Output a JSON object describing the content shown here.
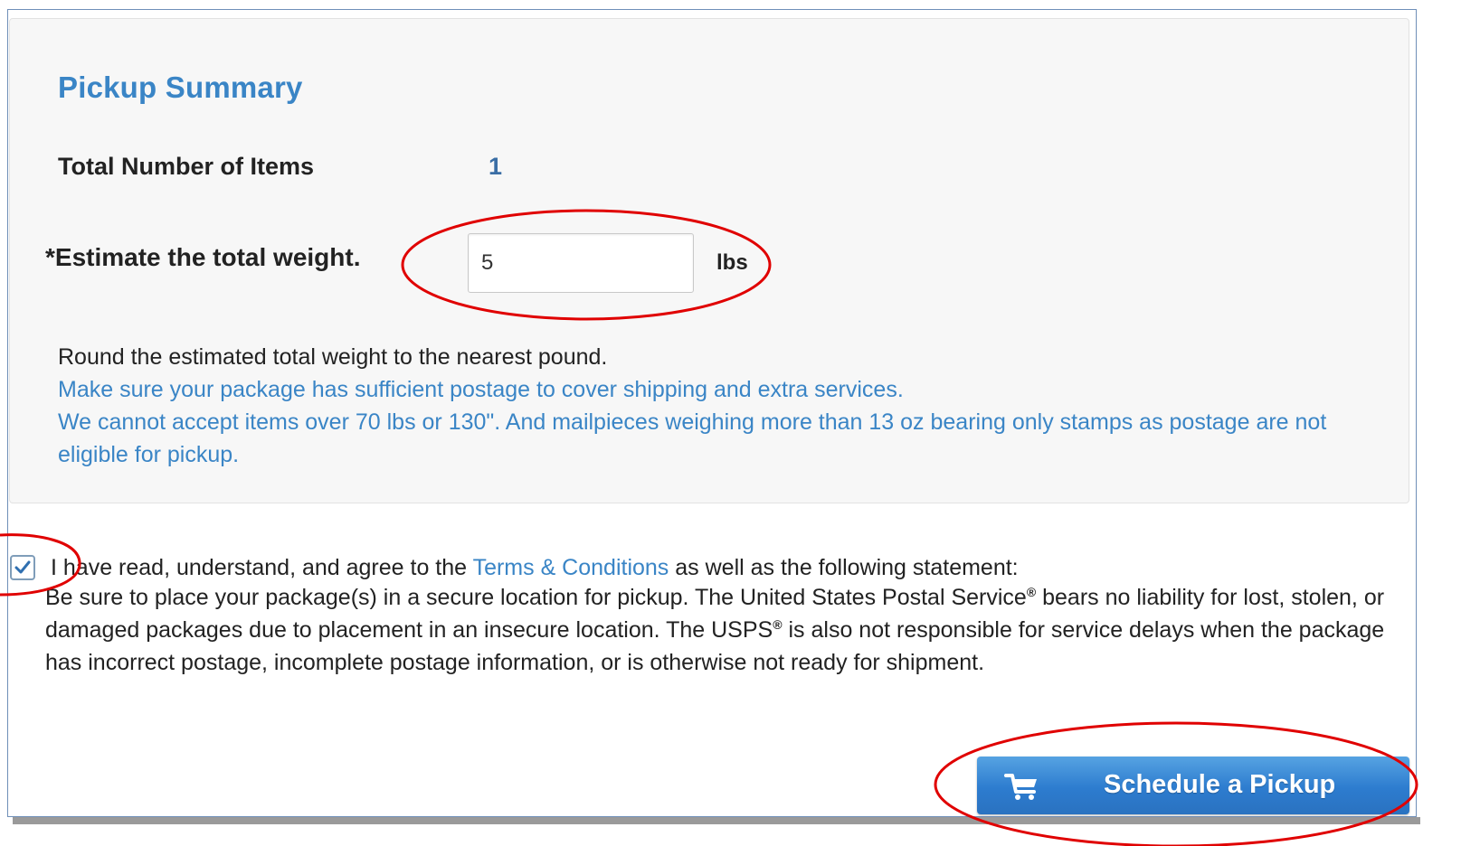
{
  "pickup_summary": {
    "title": "Pickup Summary",
    "items_label": "Total Number of Items",
    "items_value": "1",
    "weight_label": "*Estimate the total weight.",
    "weight_value": "5",
    "weight_unit": "lbs",
    "note_round": "Round the estimated total weight to the nearest pound.",
    "note_postage": "Make sure your package has sufficient postage to cover shipping and extra services.",
    "note_limits": "We cannot accept items over 70 lbs or 130\". And mailpieces weighing more than 13 oz bearing only stamps as postage are not eligible for pickup."
  },
  "agreement": {
    "checked": true,
    "prefix": "I have read, understand, and agree to the ",
    "terms_link": "Terms & Conditions",
    "suffix": " as well as the following statement:",
    "statement_1": "Be sure to place your package(s) in a secure location for pickup. The United States Postal Service",
    "reg_mark": "®",
    "statement_2": " bears no liability for lost, stolen, or damaged packages due to placement in an insecure location. The USPS",
    "statement_3": " is also not responsible for service delays when the package has incorrect postage, incomplete postage information, or is otherwise not ready for shipment."
  },
  "actions": {
    "schedule_label": "Schedule a Pickup",
    "schedule_icon": "cart-icon"
  },
  "colors": {
    "accent_blue": "#3a85c6",
    "button_blue": "#2d7ccf",
    "annotation_red": "#e00000"
  }
}
